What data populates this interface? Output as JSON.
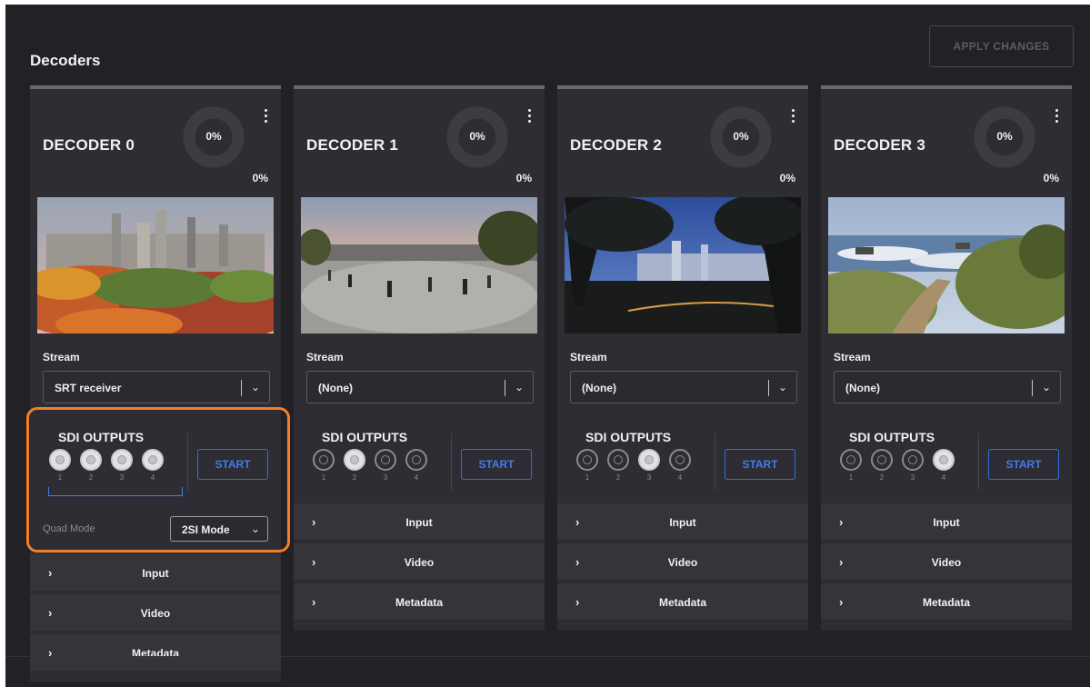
{
  "header": {
    "title": "Decoders",
    "apply_label": "APPLY CHANGES"
  },
  "colors": {
    "background": "#222226",
    "card": "#2d2d33",
    "accent": "#3d7cf0",
    "highlight": "#f07f2a"
  },
  "stream_label": "Stream",
  "sdi_title": "SDI OUTPUTS",
  "start_label": "START",
  "port_numbers": [
    "1",
    "2",
    "3",
    "4"
  ],
  "accordion": {
    "input": "Input",
    "video": "Video",
    "metadata": "Metadata"
  },
  "accordion_icon": "chevron-right-icon",
  "quad": {
    "label": "Quad Mode",
    "value": "2SI Mode"
  },
  "decoders": [
    {
      "title": "DECODER 0",
      "ring_pct": "0%",
      "small_pct": "0%",
      "stream": "SRT receiver",
      "active_ports": [
        1,
        2,
        3,
        4
      ],
      "thumb": "city-autumn"
    },
    {
      "title": "DECODER 1",
      "ring_pct": "0%",
      "small_pct": "0%",
      "stream": "(None)",
      "active_ports": [
        2
      ],
      "thumb": "plaza-dusk"
    },
    {
      "title": "DECODER 2",
      "ring_pct": "0%",
      "small_pct": "0%",
      "stream": "(None)",
      "active_ports": [
        3
      ],
      "thumb": "night-skyline"
    },
    {
      "title": "DECODER 3",
      "ring_pct": "0%",
      "small_pct": "0%",
      "stream": "(None)",
      "active_ports": [
        4
      ],
      "thumb": "coast-path"
    }
  ]
}
